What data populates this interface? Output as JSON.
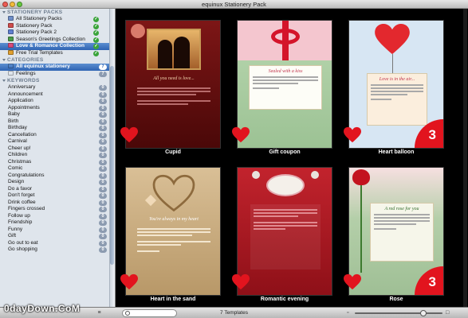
{
  "window": {
    "title": "equinux Stationery Pack"
  },
  "sidebar": {
    "packs_header": "STATIONERY PACKS",
    "packs": [
      {
        "label": "All Stationery Packs",
        "color": "#6f8fc9",
        "selected": false
      },
      {
        "label": "Stationery Pack",
        "color": "#cf4c4c",
        "selected": false
      },
      {
        "label": "Stationery Pack 2",
        "color": "#5f7fd0",
        "selected": false
      },
      {
        "label": "Season's Greetings Collection",
        "color": "#4a9a4a",
        "selected": false
      },
      {
        "label": "Love & Romance Collection",
        "color": "#d84a7a",
        "selected": true
      },
      {
        "label": "Free Trial Templates",
        "color": "#e0a030",
        "selected": false
      }
    ],
    "categories_header": "CATEGORIES",
    "categories": [
      {
        "label": "All equinux stationery",
        "count": "7",
        "selected": true
      },
      {
        "label": "Feelings",
        "count": "7",
        "selected": false
      }
    ],
    "keywords_header": "KEYWORDS",
    "keywords": [
      {
        "label": "Anniversary",
        "count": "0"
      },
      {
        "label": "Announcement",
        "count": "0"
      },
      {
        "label": "Application",
        "count": "0"
      },
      {
        "label": "Appointments",
        "count": "0"
      },
      {
        "label": "Baby",
        "count": "0"
      },
      {
        "label": "Birth",
        "count": "0"
      },
      {
        "label": "Birthday",
        "count": "0"
      },
      {
        "label": "Cancellation",
        "count": "0"
      },
      {
        "label": "Carnival",
        "count": "0"
      },
      {
        "label": "Cheer up!",
        "count": "0"
      },
      {
        "label": "Children",
        "count": "0"
      },
      {
        "label": "Christmas",
        "count": "0"
      },
      {
        "label": "Comic",
        "count": "0"
      },
      {
        "label": "Congratulations",
        "count": "0"
      },
      {
        "label": "Design",
        "count": "0"
      },
      {
        "label": "Do a favor",
        "count": "0"
      },
      {
        "label": "Don't forget",
        "count": "0"
      },
      {
        "label": "Drink coffee",
        "count": "0"
      },
      {
        "label": "Fingers crossed",
        "count": "0"
      },
      {
        "label": "Follow up",
        "count": "0"
      },
      {
        "label": "Friendship",
        "count": "0"
      },
      {
        "label": "Funny",
        "count": "0"
      },
      {
        "label": "Gift",
        "count": "0"
      },
      {
        "label": "Go out to eat",
        "count": "0"
      },
      {
        "label": "Go shopping",
        "count": "0"
      }
    ]
  },
  "templates": [
    {
      "label": "Cupid",
      "heading": "All you need is love...",
      "badge": ""
    },
    {
      "label": "Gift coupon",
      "heading": "Sealed with a kiss",
      "badge": ""
    },
    {
      "label": "Heart balloon",
      "heading": "Love is in the air...",
      "badge": "3"
    },
    {
      "label": "Heart in the sand",
      "heading": "You're always in my heart",
      "badge": ""
    },
    {
      "label": "Romantic evening",
      "heading": "",
      "badge": ""
    },
    {
      "label": "Rose",
      "heading": "A red rose for you",
      "badge": "3"
    }
  ],
  "statusbar": {
    "templates_count": "7 Templates",
    "search_placeholder": ""
  },
  "zoom": {
    "level": 0.78
  },
  "watermark": "0dayDown.CoM",
  "colors": {
    "accent": "#2f64b3",
    "badge_red": "#e2141e"
  }
}
